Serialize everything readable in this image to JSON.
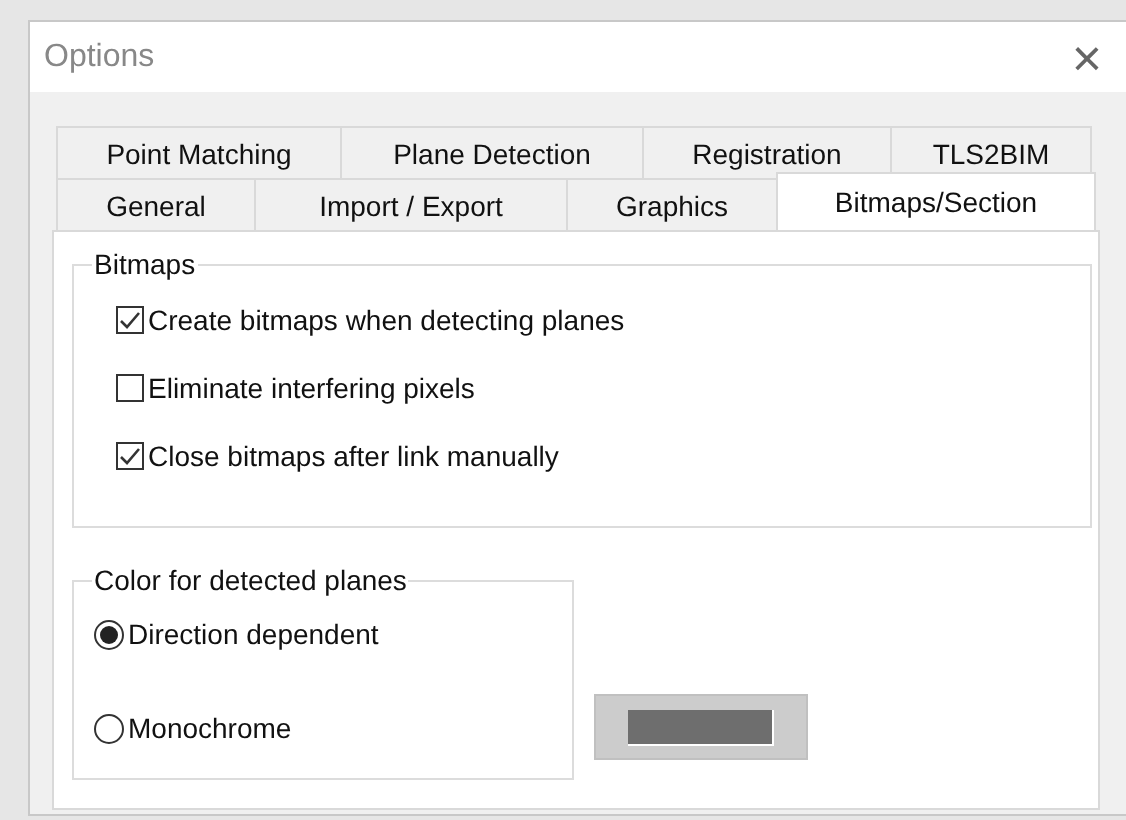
{
  "window": {
    "title": "Options",
    "close": "×"
  },
  "tab_rows": [
    [
      {
        "label": "Point Matching",
        "selected": false
      },
      {
        "label": "Plane Detection",
        "selected": false
      },
      {
        "label": "Registration",
        "selected": false
      },
      {
        "label": "TLS2BIM",
        "selected": false
      }
    ],
    [
      {
        "label": "General",
        "selected": false
      },
      {
        "label": "Import / Export",
        "selected": false
      },
      {
        "label": "Graphics",
        "selected": false
      },
      {
        "label": "Bitmaps/Section",
        "selected": true
      }
    ]
  ],
  "bitmaps": {
    "title": "Bitmaps",
    "options": [
      {
        "label": "Create bitmaps when detecting planes",
        "checked": true
      },
      {
        "label": "Eliminate interfering pixels",
        "checked": false
      },
      {
        "label": "Close bitmaps after link manually",
        "checked": true
      }
    ]
  },
  "color_group": {
    "title": "Color for detected planes",
    "options": [
      {
        "label": "Direction dependent",
        "selected": true
      },
      {
        "label": "Monochrome",
        "selected": false
      }
    ],
    "color_button": {
      "color": "#6e6e6e"
    }
  }
}
